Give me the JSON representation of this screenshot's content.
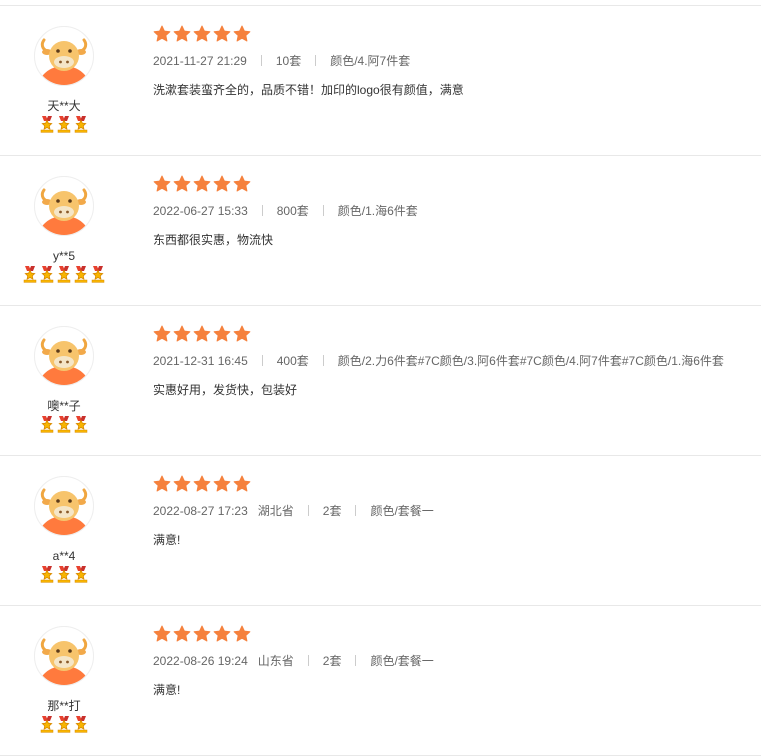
{
  "colors": {
    "star": "#f5813d",
    "medal": "#f8b500",
    "medal_ribbon": "#e8412e",
    "avatar_face": "#f7c46c",
    "avatar_body": "#ff7a3d"
  },
  "icons": {
    "rating_star": "star-icon",
    "level_medal": "medal-icon",
    "avatar": "cow-avatar-icon"
  },
  "reviews": [
    {
      "username": "天**大",
      "medal_count": 3,
      "rating": 5,
      "date": "2021-11-27 21:29",
      "region": "",
      "quantity": "10套",
      "spec": "颜色/4.阿7件套",
      "text": "洗漱套装蛮齐全的，品质不错！加印的logo很有颜值，满意"
    },
    {
      "username": "y**5",
      "medal_count": 5,
      "rating": 5,
      "date": "2022-06-27 15:33",
      "region": "",
      "quantity": "800套",
      "spec": "颜色/1.海6件套",
      "text": "东西都很实惠，物流快"
    },
    {
      "username": "噢**子",
      "medal_count": 3,
      "rating": 5,
      "date": "2021-12-31 16:45",
      "region": "",
      "quantity": "400套",
      "spec": "颜色/2.力6件套#7C颜色/3.阿6件套#7C颜色/4.阿7件套#7C颜色/1.海6件套",
      "text": "实惠好用，发货快，包装好"
    },
    {
      "username": "a**4",
      "medal_count": 3,
      "rating": 5,
      "date": "2022-08-27 17:23",
      "region": "湖北省",
      "quantity": "2套",
      "spec": "颜色/套餐一",
      "text": "满意!"
    },
    {
      "username": "那**打",
      "medal_count": 3,
      "rating": 5,
      "date": "2022-08-26 19:24",
      "region": "山东省",
      "quantity": "2套",
      "spec": "颜色/套餐一",
      "text": "满意!"
    }
  ]
}
